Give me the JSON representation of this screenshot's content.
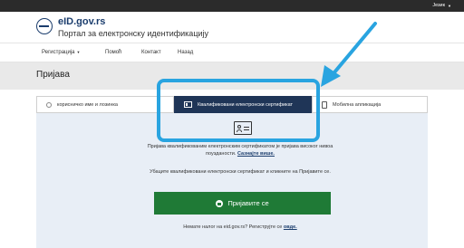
{
  "topbar": {
    "language_label": "Језик"
  },
  "header": {
    "site_title": "eID.gov.rs",
    "site_subtitle": "Портал за електронску идентификацију"
  },
  "nav": {
    "items": [
      {
        "label": "Регистрација",
        "has_dropdown": true
      },
      {
        "label": "Помоћ"
      },
      {
        "label": "Контакт"
      },
      {
        "label": "Назад"
      }
    ]
  },
  "page": {
    "title": "Пријава"
  },
  "tabs": [
    {
      "label": "корисничко име и лозинка",
      "icon": "radio-icon"
    },
    {
      "label": "Квалификовани електронски сертификат",
      "icon": "certificate-card-icon",
      "active": true
    },
    {
      "label": "Мобилна апликација",
      "icon": "mobile-phone-icon"
    }
  ],
  "panel": {
    "description_prefix": "Пријава квалификованим електронским сертификатом је пријава високог нивоа поузданости.",
    "more_link": "Сазнајте више.",
    "instruction": "Убаците квалификовани електронски сертификат и кликните на Пријавите се.",
    "login_button": "Пријавите се",
    "no_account_text": "Немате налог на eid.gov.rs? Региструјте се",
    "register_link": "овде."
  },
  "colors": {
    "accent_navy": "#1f3557",
    "button_green": "#1f7a36",
    "highlight_blue": "#29a4e0",
    "panel_bg": "#e8eef6"
  }
}
